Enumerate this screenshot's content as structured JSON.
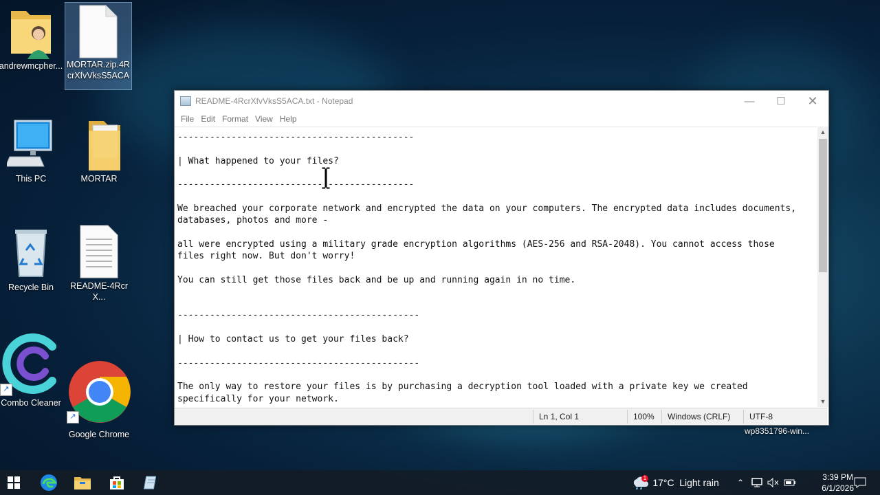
{
  "desktop": {
    "icons": [
      {
        "label": "andrewmcpher..."
      },
      {
        "label": "MORTAR.zip.4RcrXfvVksS5ACA"
      },
      {
        "label": "This PC"
      },
      {
        "label": "MORTAR"
      },
      {
        "label": "Recycle Bin"
      },
      {
        "label": "README-4RcrX..."
      },
      {
        "label": "Combo Cleaner"
      },
      {
        "label": "Google Chrome"
      }
    ],
    "file_hint": "wp8351796-win..."
  },
  "notepad": {
    "title": "README-4RcrXfvVksS5ACA.txt - Notepad",
    "menu": [
      "File",
      "Edit",
      "Format",
      "View",
      "Help"
    ],
    "content": [
      "--------------------------------------------",
      "",
      "| What happened to your files?",
      "",
      "--------------------------------------------",
      "",
      "We breached your corporate network and encrypted the data on your computers. The encrypted data includes documents,",
      "databases, photos and more -",
      "",
      "all were encrypted using a military grade encryption algorithms (AES-256 and RSA-2048). You cannot access those",
      "files right now. But don't worry!",
      "",
      "You can still get those files back and be up and running again in no time.",
      "",
      "",
      "---------------------------------------------",
      "",
      "| How to contact us to get your files back?",
      "",
      "---------------------------------------------",
      "",
      "The only way to restore your files is by purchasing a decryption tool loaded with a private key we created",
      "specifically for your network."
    ],
    "status": {
      "position": "Ln 1, Col 1",
      "zoom": "100%",
      "line_ending": "Windows (CRLF)",
      "encoding": "UTF-8"
    }
  },
  "taskbar": {
    "weather_badge": "1",
    "temperature": "17°C",
    "weather": "Light rain",
    "time": "3:39 PM",
    "date": "6/1/2026"
  }
}
